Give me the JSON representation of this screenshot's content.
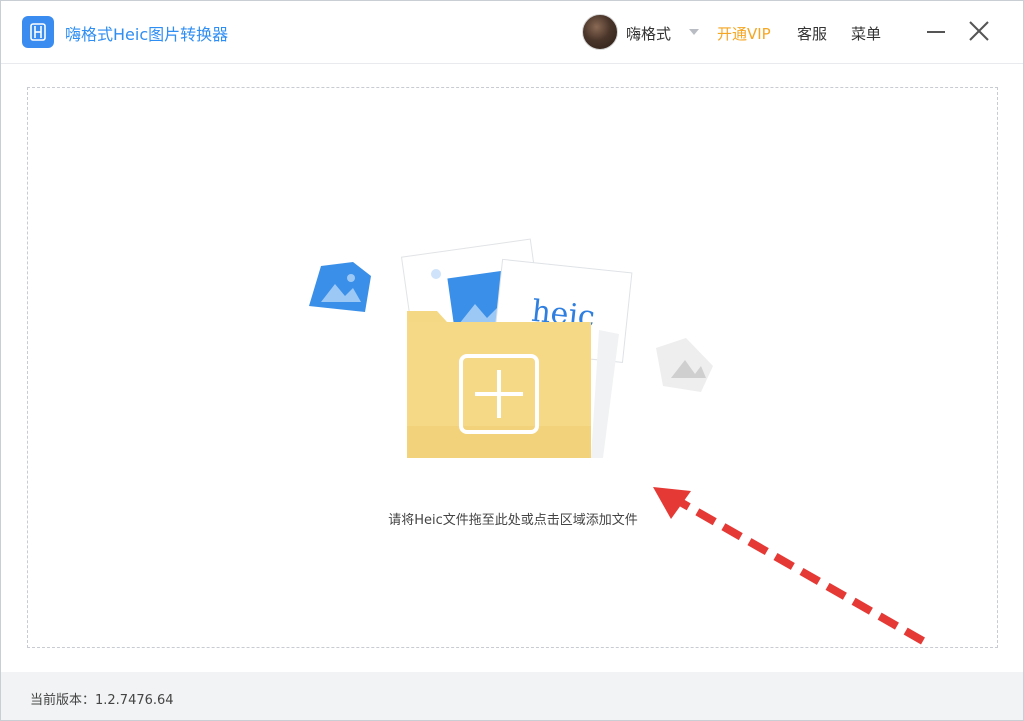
{
  "titlebar": {
    "app_title": "嗨格式Heic图片转换器",
    "username": "嗨格式",
    "vip_label": "开通VIP",
    "service_label": "客服",
    "menu_label": "菜单"
  },
  "dropzone": {
    "heic_card_text": "heic",
    "hint": "请将Heic文件拖至此处或点击区域添加文件"
  },
  "footer": {
    "version": "当前版本：1.2.7476.64"
  },
  "colors": {
    "brand": "#3b8cf0",
    "vip": "#f5a623",
    "folder": "#f3d57e",
    "arrow": "#e53935"
  },
  "icons": [
    "app-logo-icon",
    "avatar",
    "chevron-down-icon",
    "minimize-icon",
    "close-icon",
    "folder-add-icon",
    "image-file-icon",
    "arrow-annotation"
  ]
}
